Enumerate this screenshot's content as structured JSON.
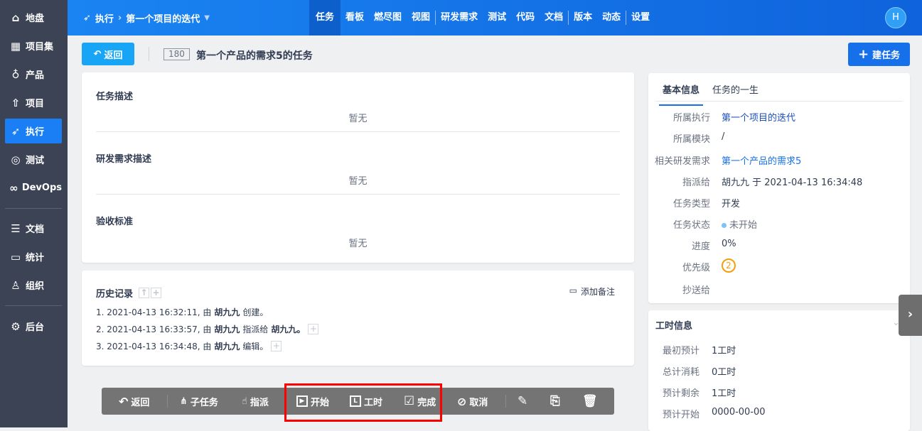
{
  "sidebar": {
    "items": [
      {
        "label": "地盘",
        "icon": "home-icon"
      },
      {
        "label": "项目集",
        "icon": "grid-icon"
      },
      {
        "label": "产品",
        "icon": "bulb-icon"
      },
      {
        "label": "项目",
        "icon": "rocket-icon"
      },
      {
        "label": "执行",
        "icon": "run-icon"
      },
      {
        "label": "测试",
        "icon": "search-icon"
      },
      {
        "label": "DevOps",
        "icon": "infinity-icon"
      },
      {
        "label": "文档",
        "icon": "doc-icon"
      },
      {
        "label": "统计",
        "icon": "chart-icon"
      },
      {
        "label": "组织",
        "icon": "users-icon"
      },
      {
        "label": "后台",
        "icon": "gear-icon"
      }
    ]
  },
  "header": {
    "crumb_root": "执行",
    "crumb_current": "第一个项目的迭代",
    "nav": [
      "任务",
      "看板",
      "燃尽图",
      "视图",
      "研发需求",
      "测试",
      "代码",
      "文档",
      "版本",
      "动态",
      "设置"
    ],
    "avatar": "H"
  },
  "titlebar": {
    "back": "返回",
    "id": "180",
    "title": "第一个产品的需求5的任务",
    "new_task": "建任务"
  },
  "main": {
    "sections": [
      {
        "title": "任务描述",
        "content": "暂无"
      },
      {
        "title": "研发需求描述",
        "content": "暂无"
      },
      {
        "title": "验收标准",
        "content": "暂无"
      }
    ]
  },
  "history": {
    "title": "历史记录",
    "add_note": "添加备注",
    "entries": [
      {
        "prefix": "1. 2021-04-13 16:32:11, 由",
        "user": "胡九九",
        "action": "创建。",
        "target": ""
      },
      {
        "prefix": "2. 2021-04-13 16:33:57, 由",
        "user": "胡九九",
        "action": "指派给",
        "target": "胡九九。"
      },
      {
        "prefix": "3. 2021-04-13 16:34:48, 由",
        "user": "胡九九",
        "action": "编辑。",
        "target": ""
      }
    ]
  },
  "toolbar": {
    "back": "返回",
    "subtask": "子任务",
    "assign": "指派",
    "start": "开始",
    "effort": "工时",
    "finish": "完成",
    "cancel": "取消"
  },
  "info": {
    "tabs": [
      "基本信息",
      "任务的一生"
    ],
    "rows": [
      {
        "label": "所属执行",
        "value": "第一个项目的迭代"
      },
      {
        "label": "所属模块",
        "value": "/"
      },
      {
        "label": "相关研发需求",
        "value": "第一个产品的需求5"
      },
      {
        "label": "指派给",
        "value": "胡九九 于 2021-04-13 16:34:48"
      },
      {
        "label": "任务类型",
        "value": "开发"
      },
      {
        "label": "任务状态",
        "value": "未开始"
      },
      {
        "label": "进度",
        "value": "0%"
      },
      {
        "label": "优先级",
        "value": "2"
      },
      {
        "label": "抄送给",
        "value": ""
      }
    ]
  },
  "effort": {
    "title": "工时信息",
    "rows": [
      {
        "label": "最初预计",
        "value": "1工时"
      },
      {
        "label": "总计消耗",
        "value": "0工时"
      },
      {
        "label": "预计剩余",
        "value": "1工时"
      },
      {
        "label": "预计开始",
        "value": "0000-00-00"
      }
    ]
  },
  "colors": {
    "sidebar": "#3c4354",
    "accent": "#1670ea",
    "status_dot": "#7cc2f7",
    "priority": "#f59e0b",
    "highlight": "#ff0000"
  }
}
